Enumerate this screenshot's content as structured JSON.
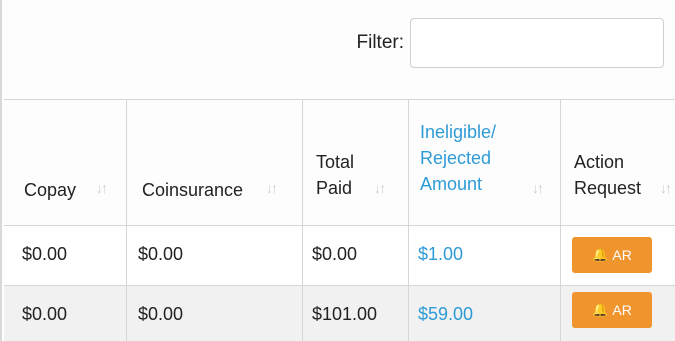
{
  "filter": {
    "label": "Filter:",
    "value": ""
  },
  "columns": [
    {
      "key": "copay",
      "label": "Copay",
      "lines": [
        "Copay"
      ]
    },
    {
      "key": "coinsurance",
      "label": "Coinsurance",
      "lines": [
        "Coinsurance"
      ]
    },
    {
      "key": "total_paid",
      "label": "Total Paid",
      "lines": [
        "Total",
        "Paid"
      ]
    },
    {
      "key": "ineligible",
      "label": "Ineligible/ Rejected Amount",
      "lines": [
        "Ineligible/",
        "Rejected",
        "Amount"
      ],
      "color": "#2e9bd6"
    },
    {
      "key": "action",
      "label": "Action Request",
      "lines": [
        "Action",
        "Request"
      ]
    }
  ],
  "sort_icon": "sort-icon",
  "rows": [
    {
      "copay": "$0.00",
      "coinsurance": "$0.00",
      "total_paid": "$0.00",
      "ineligible": "$1.00",
      "action_label": "AR",
      "action_icon": "bell-icon"
    },
    {
      "copay": "$0.00",
      "coinsurance": "$0.00",
      "total_paid": "$101.00",
      "ineligible": "$59.00",
      "action_label": "AR",
      "action_icon": "bell-icon"
    }
  ],
  "colors": {
    "accent": "#2e9bd6",
    "button": "#f0952e",
    "stripe": "#f1f1f1",
    "border": "#d6d6d6"
  }
}
